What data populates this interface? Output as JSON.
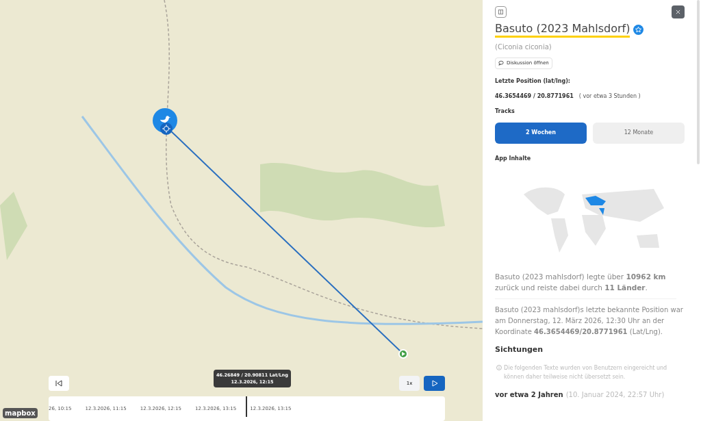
{
  "map": {
    "tooltip": {
      "coords": "46.26849 / 20.90811 Lat/Lng",
      "time": "12.3.2026, 12:15"
    },
    "speed": "1x",
    "timeline": [
      "26, 10:15",
      "12.3.2026, 11:15",
      "12.3.2026, 12:15",
      "12.3.2026, 13:15",
      "12.3.2026, 13:15"
    ],
    "attribution": "mapbox"
  },
  "panel": {
    "title": "Basuto (2023 Mahlsdorf)",
    "favorite": true,
    "species": "(Ciconia ciconia)",
    "discussion_button": "Diskussion öffnen",
    "position_label": "Letzte Position (lat/lng):",
    "position": "46.3654469 / 20.8771961",
    "position_age": "( vor etwa 3 Stunden )",
    "tracks_label": "Tracks",
    "tracks": [
      {
        "label": "2 Wochen",
        "selected": true
      },
      {
        "label": "12 Monate",
        "selected": false
      }
    ],
    "app_label": "App Inhalte",
    "summary": "Basuto (2023 mahlsdorf) legte über **10962 km** zurück und reiste dabei durch **11 Länder**.",
    "last_position": "Basuto (2023 mahlsdorf)s letzte bekannte Position war am Donnerstag, 12. März 2026, 12:30 Uhr an der Koordinate **46.3654469/20.8771961** (Lat/Lng).",
    "sightings_label": "Sichtungen",
    "sightings_note": "Die folgenden Texte wurden von Benutzern eingereicht und können daher teilweise nicht übersetzt sein.",
    "sighting": {
      "age": "vor etwa 2 Jahren",
      "date": "(10. Januar 2024, 22:57 Uhr)"
    }
  }
}
